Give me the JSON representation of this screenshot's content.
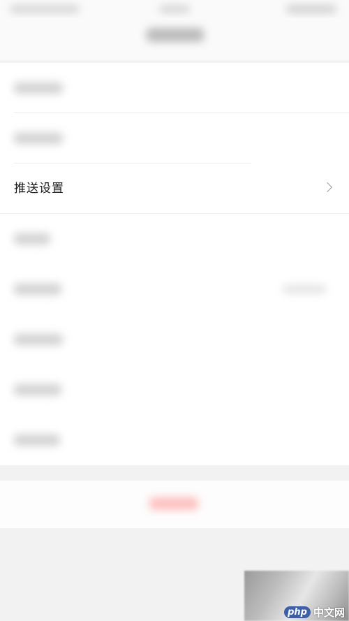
{
  "list": {
    "items": [
      {
        "label": "",
        "blurred": true
      },
      {
        "label": "",
        "blurred": true
      },
      {
        "label": "推送设置",
        "blurred": false
      },
      {
        "label": "",
        "blurred": true
      },
      {
        "label": "",
        "blurred": true
      },
      {
        "label": "",
        "blurred": true
      },
      {
        "label": "",
        "blurred": true
      },
      {
        "label": "",
        "blurred": true
      }
    ]
  },
  "watermark": {
    "badge": "php",
    "text": "中文网"
  },
  "colors": {
    "background": "#f2f2f2",
    "row_background": "#ffffff",
    "logout_accent": "#ff6b6b"
  },
  "icons": {
    "row_arrow": "chevron-right-icon"
  }
}
